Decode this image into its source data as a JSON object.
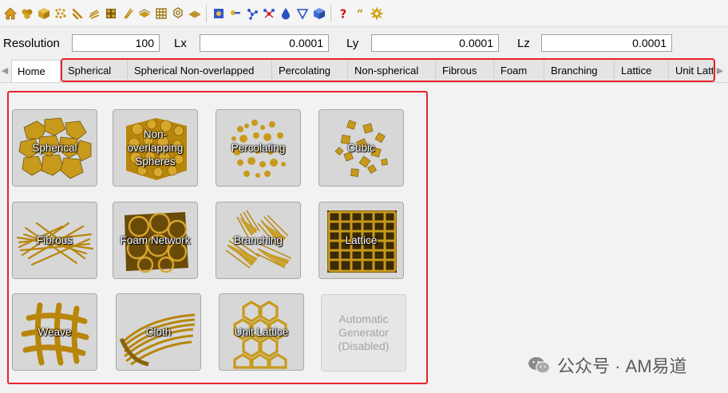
{
  "toolbar": {
    "icons": [
      "home-icon",
      "spheres-icon",
      "cube-icon",
      "percolating-icon",
      "fibrous-icon",
      "branching-icon",
      "foam-icon",
      "needle-icon",
      "sheets-icon",
      "lattice-icon",
      "hexagon-icon",
      "grid-icon",
      "settings-sample-icon",
      "key-icon",
      "molecule-icon",
      "red-molecule-icon",
      "drop-icon",
      "triangle-icon",
      "box-icon",
      "help-icon",
      "quote-icon",
      "gear-icon"
    ]
  },
  "params": {
    "resolution_label": "Resolution",
    "resolution_value": "100",
    "lx_label": "Lx",
    "lx_value": "0.0001",
    "ly_label": "Ly",
    "ly_value": "0.0001",
    "lz_label": "Lz",
    "lz_value": "0.0001"
  },
  "tabs": [
    {
      "label": "Home"
    },
    {
      "label": "Spherical"
    },
    {
      "label": "Spherical Non-overlapped"
    },
    {
      "label": "Percolating"
    },
    {
      "label": "Non-spherical"
    },
    {
      "label": "Fibrous"
    },
    {
      "label": "Foam"
    },
    {
      "label": "Branching"
    },
    {
      "label": "Lattice"
    },
    {
      "label": "Unit Lattice"
    }
  ],
  "tiles": [
    {
      "label": "Spherical"
    },
    {
      "label": "Non-overlapping Spheres"
    },
    {
      "label": "Percolating"
    },
    {
      "label": "Cubic"
    },
    {
      "label": "Fibrous"
    },
    {
      "label": "Foam Network"
    },
    {
      "label": "Branching"
    },
    {
      "label": "Lattice"
    },
    {
      "label": "Weave"
    },
    {
      "label": "Cloth"
    },
    {
      "label": "Unit Lattice"
    },
    {
      "label": "Automatic Generator (Disabled)"
    }
  ],
  "colors": {
    "accent_gold": "#c89a1c",
    "highlight_red": "#e8232b"
  },
  "watermark": {
    "text": "公众号 · AM易道"
  }
}
